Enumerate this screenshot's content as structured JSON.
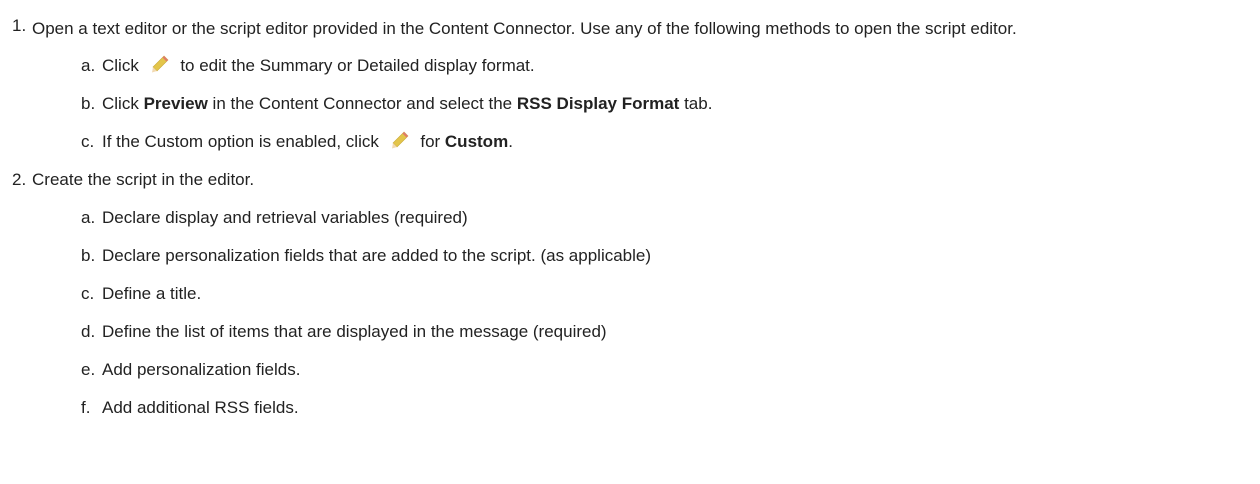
{
  "steps": [
    {
      "number": "1.",
      "text": "Open a text editor or the script editor provided in the Content Connector. Use any of the following methods to open the script editor.",
      "substeps": [
        {
          "letter": "a.",
          "before": "Click",
          "icon": "pencil-icon",
          "after": "to edit the Summary or Detailed display format."
        },
        {
          "letter": "b.",
          "t1": "Click ",
          "b1": "Preview",
          "t2": " in the Content Connector and select the ",
          "b2": "RSS Display Format",
          "t3": " tab."
        },
        {
          "letter": "c.",
          "before": "If the Custom option is enabled, click",
          "icon": "pencil-icon",
          "after": "for ",
          "bold": "Custom",
          "end": "."
        }
      ]
    },
    {
      "number": "2.",
      "text": "Create the script in the editor.",
      "substeps": [
        {
          "letter": "a.",
          "text": "Declare display and retrieval variables (required)"
        },
        {
          "letter": "b.",
          "text": "Declare personalization fields that are added to the script. (as applicable)"
        },
        {
          "letter": "c.",
          "text": "Define a title."
        },
        {
          "letter": "d.",
          "text": "Define the list of items that are displayed in the message (required)"
        },
        {
          "letter": "e.",
          "text": "Add personalization fields."
        },
        {
          "letter": "f.",
          "text": "Add additional RSS fields."
        }
      ]
    }
  ],
  "colors": {
    "text": "#222222",
    "pencil": "#d9b838",
    "pencil_tip": "#e07a6a"
  }
}
